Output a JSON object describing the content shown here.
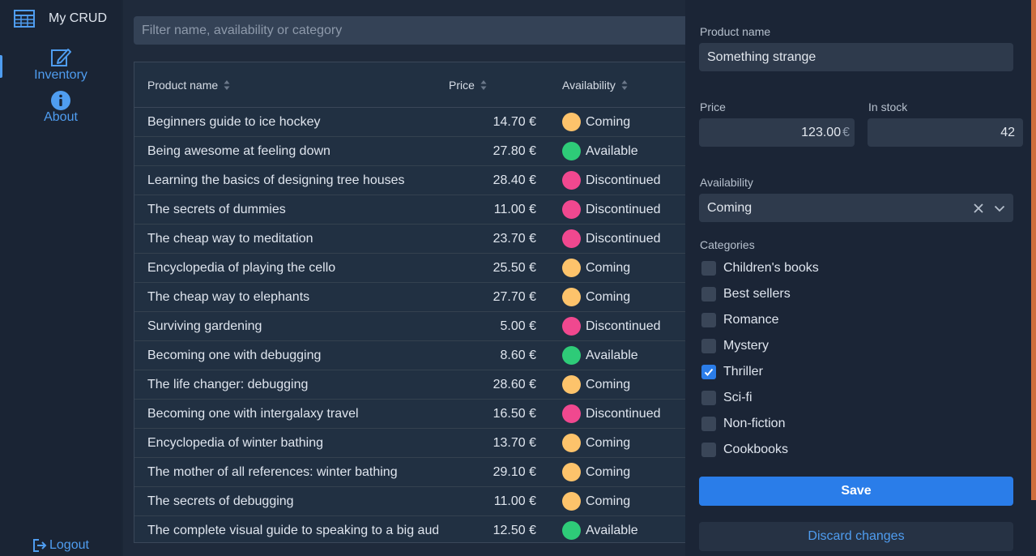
{
  "app": {
    "title": "My CRUD"
  },
  "nav": {
    "inventory_label": "Inventory",
    "about_label": "About",
    "logout_label": "Logout"
  },
  "filter": {
    "placeholder": "Filter name, availability or category",
    "value": ""
  },
  "grid": {
    "columns": [
      "Product name",
      "Price",
      "Availability"
    ],
    "rows": [
      {
        "name": "Beginners guide to ice hockey",
        "price": "14.70 €",
        "availability": "Coming"
      },
      {
        "name": "Being awesome at feeling down",
        "price": "27.80 €",
        "availability": "Available"
      },
      {
        "name": "Learning the basics of designing tree houses",
        "price": "28.40 €",
        "availability": "Discontinued"
      },
      {
        "name": "The secrets of dummies",
        "price": "11.00 €",
        "availability": "Discontinued"
      },
      {
        "name": "The cheap way to meditation",
        "price": "23.70 €",
        "availability": "Discontinued"
      },
      {
        "name": "Encyclopedia of playing the cello",
        "price": "25.50 €",
        "availability": "Coming"
      },
      {
        "name": "The cheap way to elephants",
        "price": "27.70 €",
        "availability": "Coming"
      },
      {
        "name": "Surviving gardening",
        "price": "5.00 €",
        "availability": "Discontinued"
      },
      {
        "name": "Becoming one with debugging",
        "price": "8.60 €",
        "availability": "Available"
      },
      {
        "name": "The life changer: debugging",
        "price": "28.60 €",
        "availability": "Coming"
      },
      {
        "name": "Becoming one with intergalaxy travel",
        "price": "16.50 €",
        "availability": "Discontinued"
      },
      {
        "name": "Encyclopedia of winter bathing",
        "price": "13.70 €",
        "availability": "Coming"
      },
      {
        "name": "The mother of all references: winter bathing",
        "price": "29.10 €",
        "availability": "Coming"
      },
      {
        "name": "The secrets of debugging",
        "price": "11.00 €",
        "availability": "Coming"
      },
      {
        "name": "The complete visual guide to speaking to a big audience",
        "price": "12.50 €",
        "availability": "Available"
      }
    ]
  },
  "status_colors": {
    "Coming": "#fdc36b",
    "Available": "#2ecb78",
    "Discontinued": "#f0488f"
  },
  "editor": {
    "product_name_label": "Product name",
    "product_name_value": "Something strange",
    "price_label": "Price",
    "price_value": "123.00",
    "price_suffix": "€",
    "stock_label": "In stock",
    "stock_value": "42",
    "availability_label": "Availability",
    "availability_value": "Coming",
    "categories_label": "Categories",
    "categories": [
      {
        "label": "Children's books",
        "checked": false
      },
      {
        "label": "Best sellers",
        "checked": false
      },
      {
        "label": "Romance",
        "checked": false
      },
      {
        "label": "Mystery",
        "checked": false
      },
      {
        "label": "Thriller",
        "checked": true
      },
      {
        "label": "Sci-fi",
        "checked": false
      },
      {
        "label": "Non-fiction",
        "checked": false
      },
      {
        "label": "Cookbooks",
        "checked": false
      }
    ],
    "save_label": "Save",
    "discard_label": "Discard changes"
  },
  "colors": {
    "accent": "#2a7de9",
    "link": "#4f9df0",
    "edge_accent": "#cf6e3d"
  }
}
